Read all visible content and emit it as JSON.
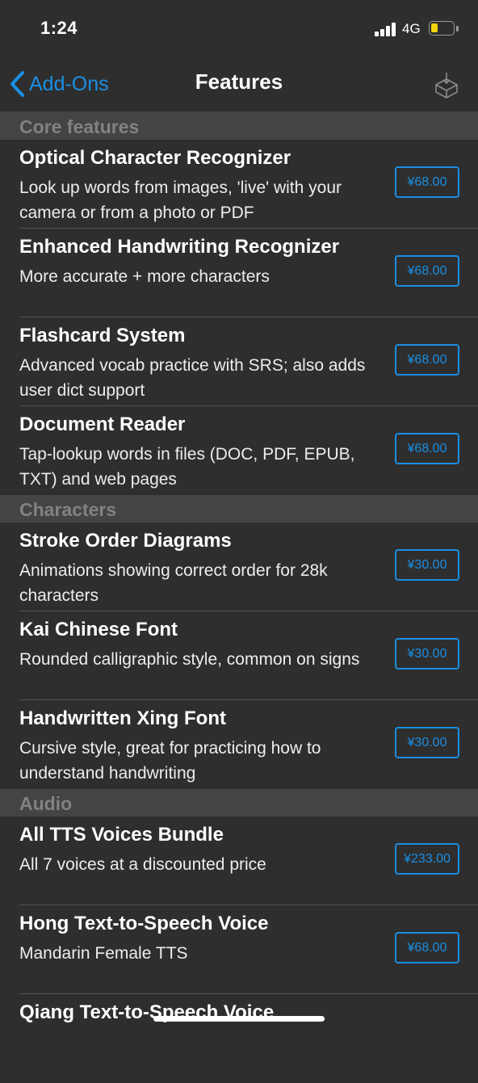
{
  "status_bar": {
    "time": "1:24",
    "network": "4G",
    "battery_color": "#f2d20b"
  },
  "nav": {
    "back_label": "Add-Ons",
    "title": "Features",
    "accent": "#1a8fe3"
  },
  "sections": [
    {
      "header": "Core features",
      "items": [
        {
          "title": "Optical Character Recognizer",
          "desc": "Look up words from images, 'live' with your camera or from a photo or PDF",
          "price": "¥68.00"
        },
        {
          "title": "Enhanced Handwriting Recognizer",
          "desc": "More accurate + more characters",
          "price": "¥68.00"
        },
        {
          "title": "Flashcard System",
          "desc": "Advanced vocab practice with SRS; also adds user dict support",
          "price": "¥68.00"
        },
        {
          "title": "Document Reader",
          "desc": "Tap-lookup words in files (DOC, PDF, EPUB, TXT) and web pages",
          "price": "¥68.00"
        }
      ]
    },
    {
      "header": "Characters",
      "items": [
        {
          "title": "Stroke Order Diagrams",
          "desc": "Animations showing correct order for 28k characters",
          "price": "¥30.00"
        },
        {
          "title": "Kai Chinese Font",
          "desc": "Rounded calligraphic style, common on signs",
          "price": "¥30.00"
        },
        {
          "title": "Handwritten Xing Font",
          "desc": "Cursive style, great for practicing how to understand handwriting",
          "price": "¥30.00"
        }
      ]
    },
    {
      "header": "Audio",
      "items": [
        {
          "title": "All TTS Voices Bundle",
          "desc": "All 7 voices at a discounted price",
          "price": "¥233.00"
        },
        {
          "title": "Hong Text-to-Speech Voice",
          "desc": "Mandarin Female TTS",
          "price": "¥68.00"
        },
        {
          "title": "Qiang Text-to-Speech Voice",
          "desc": "",
          "price": ""
        }
      ]
    }
  ]
}
